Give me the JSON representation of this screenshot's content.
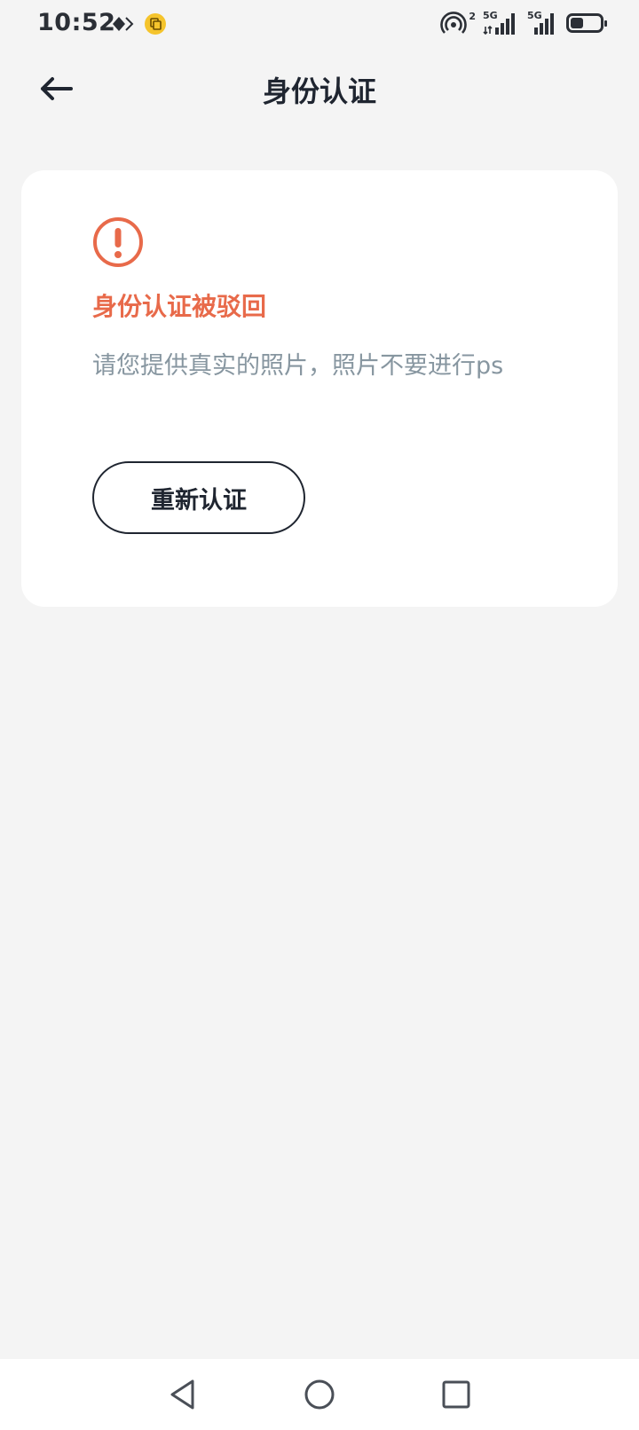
{
  "status_bar": {
    "time": "10:52",
    "hotspot_count": "2",
    "sim1_network": "5G",
    "sim2_network": "5G",
    "battery_level": 0.45,
    "icons": [
      "nfc-diamond-icon",
      "app-notification-icon",
      "hotspot-icon",
      "signal-icon",
      "battery-icon"
    ]
  },
  "header": {
    "title": "身份认证",
    "back_icon": "arrow-left-icon"
  },
  "card": {
    "alert_icon": "exclamation-circle-icon",
    "status_title": "身份认证被驳回",
    "description": "请您提供真实的照片，照片不要进行ps",
    "retry_label": "重新认证"
  },
  "colors": {
    "background": "#f4f4f4",
    "card": "#ffffff",
    "error_accent": "#e86a4a",
    "description_text": "#8796a0",
    "primary_text": "#1f2530"
  },
  "nav_bar": {
    "buttons": [
      "back-triangle-icon",
      "home-circle-icon",
      "recents-square-icon"
    ]
  }
}
